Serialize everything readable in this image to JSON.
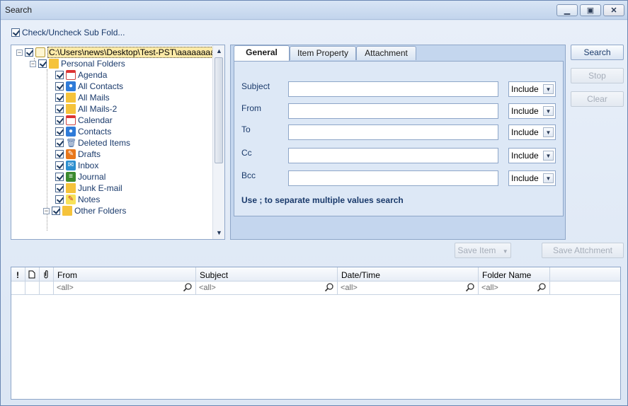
{
  "window": {
    "title": "Search"
  },
  "top_checkbox": {
    "label": "Check/Uncheck Sub Fold...",
    "checked": true
  },
  "tree": {
    "root": "C:\\Users\\news\\Desktop\\Test-PST\\aaaaaaaaaa",
    "personal": "Personal Folders",
    "items": [
      {
        "label": "Agenda",
        "icon": "calendar-icon"
      },
      {
        "label": "All Contacts",
        "icon": "contacts-icon"
      },
      {
        "label": "All Mails",
        "icon": "folder-icon"
      },
      {
        "label": "All Mails-2",
        "icon": "folder-icon"
      },
      {
        "label": "Calendar",
        "icon": "calendar-icon"
      },
      {
        "label": "Contacts",
        "icon": "contacts-icon"
      },
      {
        "label": "Deleted Items",
        "icon": "trash-icon"
      },
      {
        "label": "Drafts",
        "icon": "drafts-icon"
      },
      {
        "label": "Inbox",
        "icon": "inbox-icon"
      },
      {
        "label": "Journal",
        "icon": "journal-icon"
      },
      {
        "label": "Junk E-mail",
        "icon": "folder-icon"
      },
      {
        "label": "Notes",
        "icon": "notes-icon"
      },
      {
        "label": "Other Folders",
        "icon": "folder-icon"
      }
    ]
  },
  "tabs": {
    "general": "General",
    "item_property": "Item Property",
    "attachment": "Attachment"
  },
  "fields": {
    "subject": "Subject",
    "from": "From",
    "to": "To",
    "cc": "Cc",
    "bcc": "Bcc",
    "include": "Include"
  },
  "hint": "Use ; to separate multiple values search",
  "buttons": {
    "search": "Search",
    "stop": "Stop",
    "clear": "Clear",
    "save_item": "Save Item",
    "save_attachment": "Save Attchment"
  },
  "grid": {
    "icon_cols": [
      "!",
      "",
      ""
    ],
    "columns": [
      "From",
      "Subject",
      "Date/Time",
      "Folder Name"
    ],
    "filter_placeholder": "<all>"
  }
}
